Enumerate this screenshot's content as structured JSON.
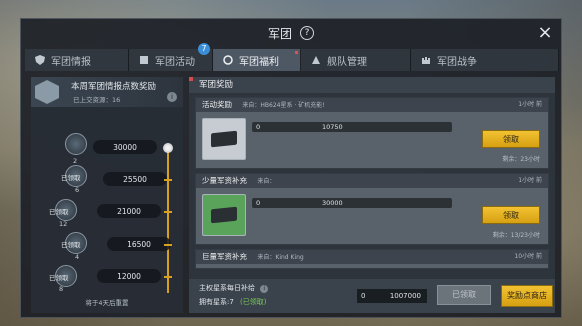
{
  "window": {
    "title": "军团",
    "help": "?",
    "close": "×"
  },
  "tabs": [
    {
      "label": "军团情报",
      "icon": "shield-icon"
    },
    {
      "label": "军团活动",
      "icon": "flag-icon",
      "badge": "7"
    },
    {
      "label": "军团福利",
      "icon": "gift-icon",
      "active": true
    },
    {
      "label": "舰队管理",
      "icon": "fleet-icon"
    },
    {
      "label": "军团战争",
      "icon": "castle-icon"
    }
  ],
  "left_panel": {
    "title": "本周军团情报点数奖励",
    "subtitle": "已上交资源：16",
    "info": "i",
    "milestones": [
      {
        "value": "30000",
        "label": "",
        "sub": "2"
      },
      {
        "value": "25500",
        "label": "已领取",
        "sub": "6"
      },
      {
        "value": "21000",
        "label": "已领取",
        "sub": "12"
      },
      {
        "value": "16500",
        "label": "已领取",
        "sub": "4"
      },
      {
        "value": "12000",
        "label": "已领取",
        "sub": "8"
      }
    ],
    "reset_text": "将于4天后重置"
  },
  "right_panel": {
    "title": "军团奖励",
    "cards": [
      {
        "name": "活动奖励",
        "source": "来自：HB624星系 · 矿机充能!",
        "time": "1小时 前",
        "current": "0",
        "target": "10750",
        "claim_label": "领取",
        "remain": "剩余：23小时"
      },
      {
        "name": "少量军资补充",
        "source": "来自：",
        "time": "1小时 前",
        "current": "0",
        "target": "30000",
        "claim_label": "领取",
        "remain": "剩余：13/23小时"
      },
      {
        "name": "巨量军资补充",
        "source": "来自：Kind King",
        "time": "10小时 前"
      }
    ],
    "footer": {
      "line1": "主权星系每日补给",
      "line2": "拥有星系:7",
      "line2_status": "(已领取)",
      "info": "i",
      "box_value": "1007000",
      "box_label": "0",
      "disabled_label": "已领取",
      "shop_label": "奖励点商店"
    }
  }
}
